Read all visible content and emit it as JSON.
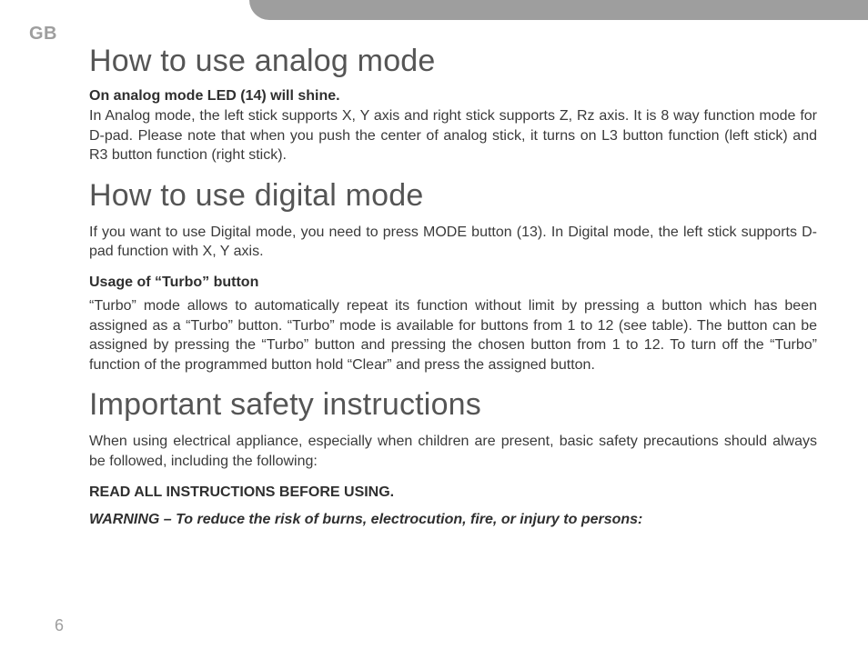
{
  "region": "GB",
  "page_number": "6",
  "sections": {
    "analog": {
      "heading": "How to use analog mode",
      "lead": "On analog mode LED (14) will shine.",
      "body": "In Analog mode, the left stick supports X, Y axis and right stick supports Z, Rz axis. It is 8 way function mode for D-pad. Please note that when you push the center of analog stick, it turns on L3 button function (left stick) and R3 button function (right stick)."
    },
    "digital": {
      "heading": "How to use digital mode",
      "body": "If you want to use Digital mode, you need to press MODE button (13). In Digital mode, the left stick supports D-pad function with X, Y axis.",
      "turbo_label": "Usage of “Turbo” button",
      "turbo_body": "“Turbo” mode allows to automatically repeat its function without limit by pressing a button which has been assigned as a “Turbo” button. “Turbo” mode is available for buttons from 1 to 12 (see table). The button can be assigned by pressing the “Turbo” button and pressing the chosen button from 1 to 12. To turn off the “Turbo” function of the programmed button hold “Clear” and press the assigned button."
    },
    "safety": {
      "heading": "Important safety instructions",
      "body": "When using electrical appliance, especially when children are present, basic safety precautions should always be followed, including the following:",
      "read_all": "READ ALL INSTRUCTIONS BEFORE USING.",
      "warning": "WARNING – To reduce the risk of burns, electrocution, fire, or injury to persons:"
    }
  }
}
